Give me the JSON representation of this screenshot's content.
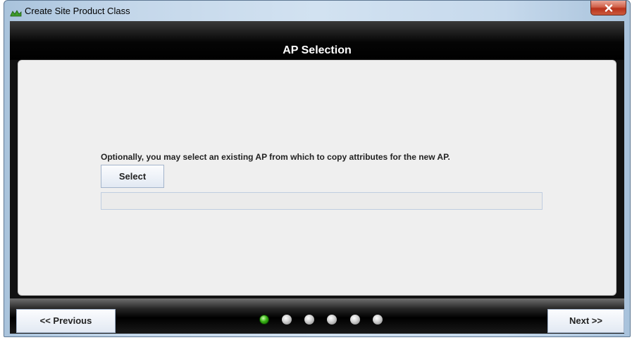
{
  "window": {
    "title": "Create Site Product Class",
    "close_label": "x"
  },
  "header": {
    "title": "AP Selection"
  },
  "main": {
    "instruction": "Optionally, you may select an existing AP from which to copy attributes for the new AP.",
    "select_label": "Select",
    "selected_ap_value": ""
  },
  "footer": {
    "previous_label": "<< Previous",
    "next_label": "Next >>",
    "steps_total": 6,
    "current_step": 1
  },
  "colors": {
    "header_bg": "#000000",
    "panel_bg": "#efefef",
    "active_step": "#39b214",
    "close_button": "#c8452f"
  }
}
